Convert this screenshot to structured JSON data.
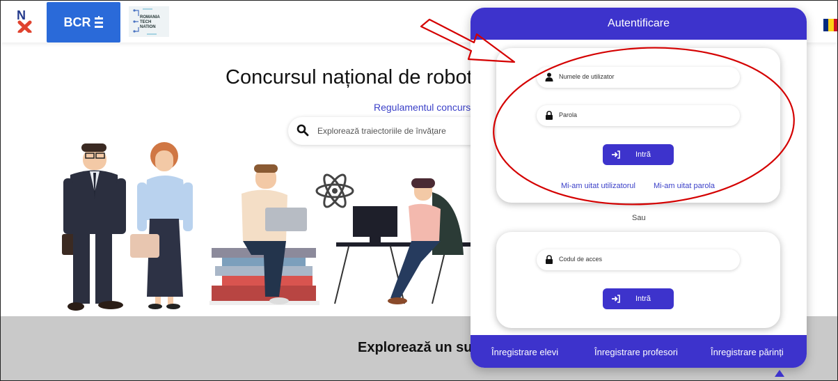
{
  "header": {
    "logo_text": "N",
    "bcr_label": "BCR",
    "rtn_logo_text": "ROMANIA TECH NATION"
  },
  "hero": {
    "title": "Concursul național de robotic",
    "reg_link": "Regulamentul concursu",
    "search_placeholder": "Explorează traiectoriile de învățare"
  },
  "band": {
    "title": "Explorează un sul"
  },
  "login": {
    "title": "Autentificare",
    "username_placeholder": "Numele de utilizator",
    "password_placeholder": "Parola",
    "enter_label": "Intră",
    "forgot_user": "Mi-am uitat utilizatorul",
    "forgot_pass": "Mi-am uitat parola",
    "or_label": "Sau",
    "code_placeholder": "Codul de acces",
    "enter_label_2": "Intră",
    "register": [
      "Înregistrare elevi",
      "Înregistrare profesori",
      "Înregistrare părinți"
    ]
  },
  "colors": {
    "accent": "#3d33cc",
    "annotation": "#d40000",
    "bcr_blue": "#2a6ad9"
  }
}
